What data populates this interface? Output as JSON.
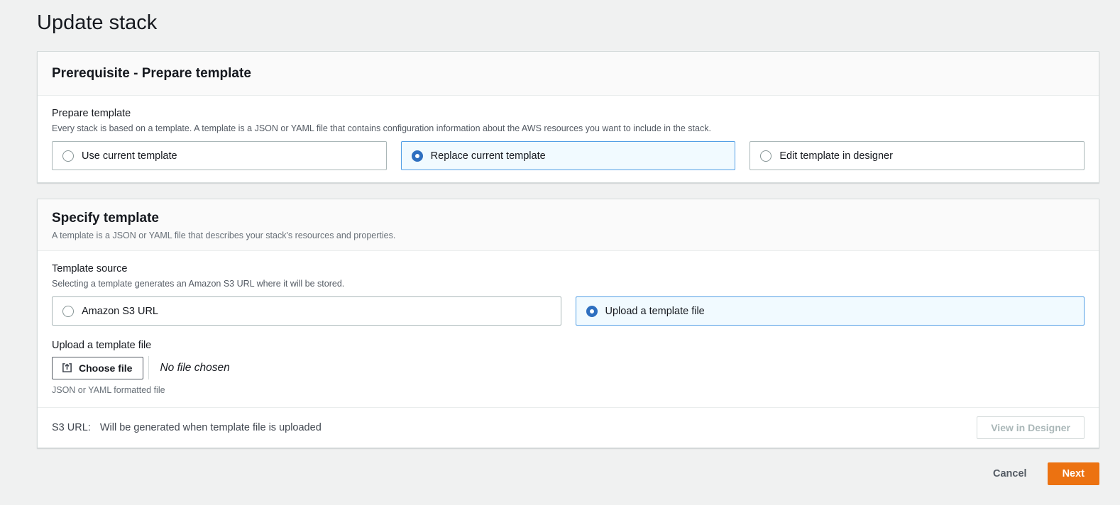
{
  "page": {
    "title": "Update stack",
    "background_color": "#f0f1f1",
    "accent_orange": "#ec7211",
    "radio_selected_blue": "#2e6fc0",
    "selected_tile_bg": "#f1faff",
    "selected_tile_border": "#539fe5"
  },
  "prerequisite_card": {
    "title": "Prerequisite - Prepare template",
    "prepare_template": {
      "label": "Prepare template",
      "description": "Every stack is based on a template. A template is a JSON or YAML file that contains configuration information about the AWS resources you want to include in the stack.",
      "options": [
        {
          "label": "Use current template",
          "selected": false
        },
        {
          "label": "Replace current template",
          "selected": true
        },
        {
          "label": "Edit template in designer",
          "selected": false
        }
      ]
    }
  },
  "specify_card": {
    "title": "Specify template",
    "subtitle": "A template is a JSON or YAML file that describes your stack's resources and properties.",
    "template_source": {
      "label": "Template source",
      "description": "Selecting a template generates an Amazon S3 URL where it will be stored.",
      "options": [
        {
          "label": "Amazon S3 URL",
          "selected": false
        },
        {
          "label": "Upload a template file",
          "selected": true
        }
      ]
    },
    "upload": {
      "label": "Upload a template file",
      "choose_file_button": "Choose file",
      "no_file_text": "No file chosen",
      "helper": "JSON or YAML formatted file"
    },
    "footer": {
      "s3_url_label": "S3 URL:",
      "s3_url_value": "Will be generated when template file is uploaded",
      "view_in_designer_button": "View in Designer",
      "view_in_designer_enabled": false
    }
  },
  "actions": {
    "cancel_label": "Cancel",
    "next_label": "Next"
  }
}
